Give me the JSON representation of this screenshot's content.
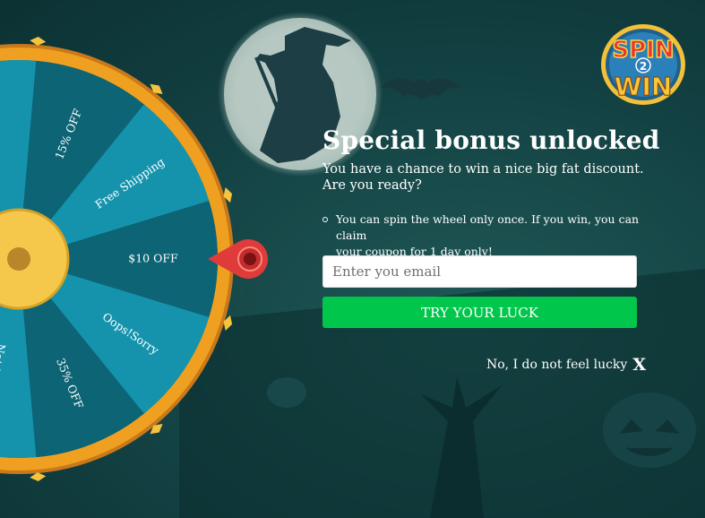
{
  "logo": {
    "line1": "SPIN",
    "mid": "2",
    "line2": "WIN"
  },
  "popup": {
    "title": "Special bonus unlocked",
    "subtitle_line1": "You have a chance to win a nice big fat discount.",
    "subtitle_line2": "Are you ready?",
    "note_line1": "You can spin the wheel only once. If you win, you can claim",
    "note_line2": "your coupon for 1 day only!",
    "email_placeholder": "Enter you email",
    "email_value": "",
    "button_label": "TRY YOUR LUCK",
    "decline_label": "No, I do not feel lucky",
    "decline_x": "X"
  },
  "wheel": {
    "segments": [
      "Oops!Sorry",
      "15% OFF",
      "Free Shipping",
      "$10 OFF",
      "Oops!Sorry",
      "35% OFF",
      "Not Lucky Today"
    ],
    "colors": {
      "dark": "#0d6475",
      "light": "#1593ad",
      "rim": "#f0a020",
      "hub": "#f2c248",
      "pointer": "#e03b3b"
    }
  }
}
